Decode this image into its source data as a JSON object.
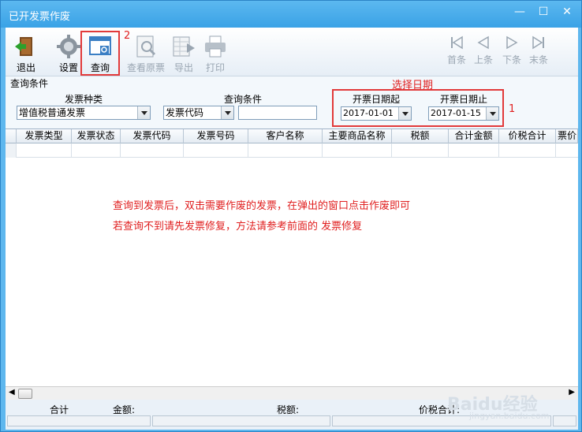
{
  "window": {
    "title": "已开发票作废",
    "min": "—",
    "max": "☐",
    "close": "✕"
  },
  "toolbar": {
    "exit": "退出",
    "settings": "设置",
    "query": "查询",
    "view_original": "查看原票",
    "export": "导出",
    "print": "打印",
    "first": "首条",
    "prev": "上条",
    "next": "下条",
    "last": "末条"
  },
  "annotations": {
    "step2": "2",
    "select_date": "选择日期",
    "step1": "1"
  },
  "query": {
    "section_title": "查询条件",
    "invoice_type_label": "发票种类",
    "invoice_type_value": "增值税普通发票",
    "condition_label": "查询条件",
    "condition_value": "发票代码",
    "condition_input": "",
    "date_from_label": "开票日期起",
    "date_from_value": "2017-01-01",
    "date_to_label": "开票日期止",
    "date_to_value": "2017-01-15"
  },
  "grid": {
    "columns": [
      "发票类型",
      "发票状态",
      "发票代码",
      "发票号码",
      "客户名称",
      "主要商品名称",
      "税额",
      "合计金额",
      "价税合计",
      "票价"
    ]
  },
  "notes": {
    "line1": "查询到发票后，双击需要作废的发票，在弹出的窗口点击作废即可",
    "line2": "若查询不到请先发票修复，方法请参考前面的 发票修复"
  },
  "footer": {
    "total": "合计",
    "amount": "金额:",
    "tax": "税额:",
    "tax_total": "价税合计:"
  },
  "watermark": {
    "text": "Baidu经验",
    "sub": "jingyan.baidu.com"
  }
}
